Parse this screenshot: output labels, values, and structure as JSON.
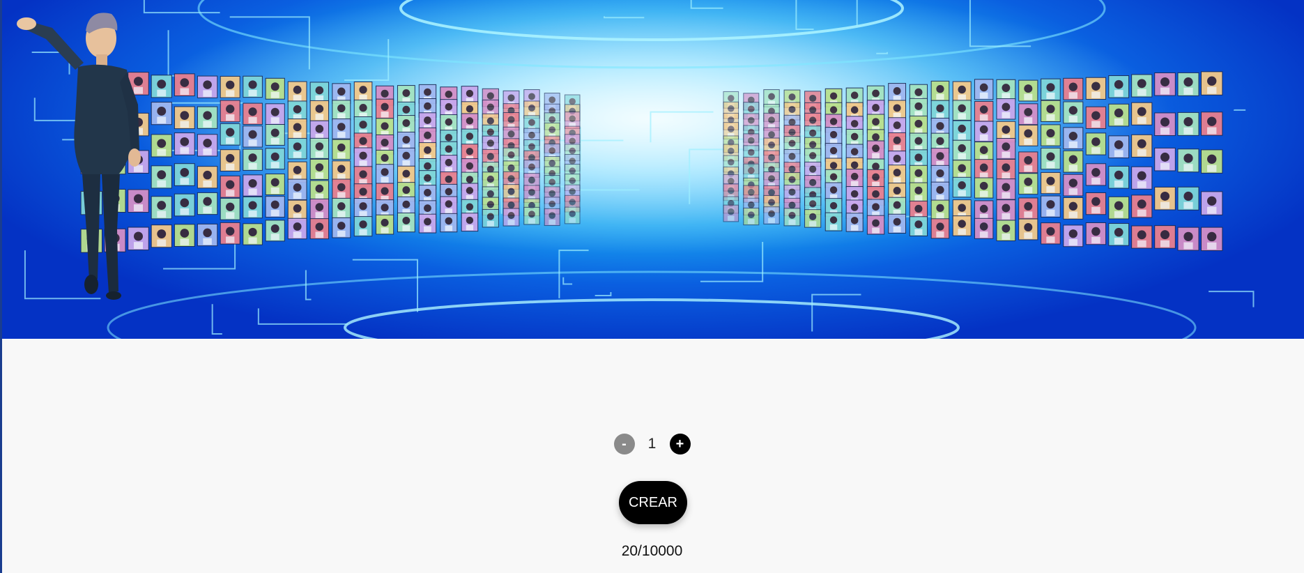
{
  "banner": {
    "image": "metaverse-avatars-banner",
    "figure": "floating-man"
  },
  "mint": {
    "decrement_label": "-",
    "quantity": "1",
    "increment_label": "+",
    "button_label": "CREAR",
    "supply": "20/10000"
  },
  "colors": {
    "banner_dark": "#0432c4",
    "banner_light": "#bff3ff",
    "page_bg": "#f8f8f8",
    "button_bg": "#000000",
    "decrement_bg": "#8a8a8a"
  }
}
